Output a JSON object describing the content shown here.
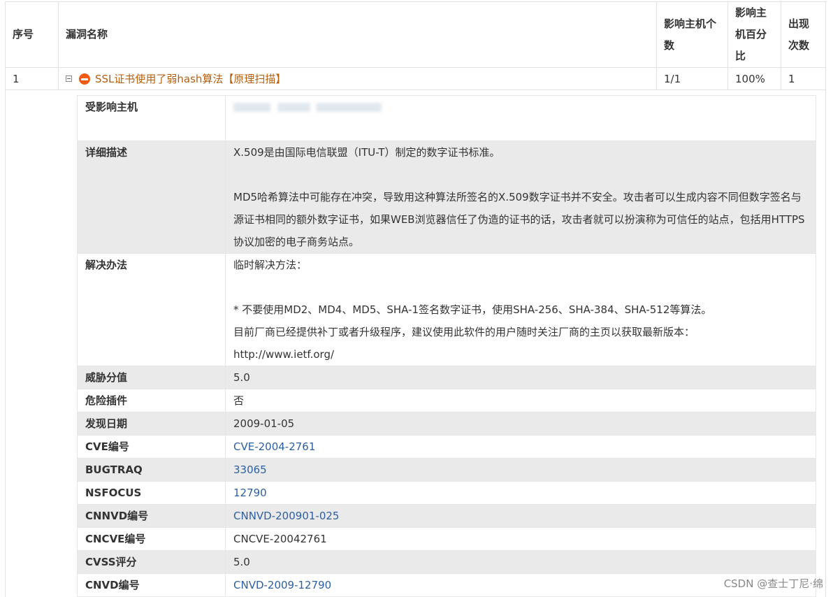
{
  "headers": {
    "seq": "序号",
    "name": "漏洞名称",
    "host_count": "影响主机个数",
    "host_pct": "影响主机百分比",
    "occurrences": "出现次数"
  },
  "vuln": {
    "seq": "1",
    "name": "SSL证书使用了弱hash算法【原理扫描】",
    "host_count": "1/1",
    "host_pct": "100%",
    "occurrences": "1",
    "icon": "danger-minus-icon",
    "expanded": true
  },
  "detail": {
    "affected_host": {
      "label": "受影响主机",
      "value": ""
    },
    "description": {
      "label": "详细描述",
      "p1": "X.509是由国际电信联盟（ITU-T）制定的数字证书标准。",
      "p2": "MD5哈希算法中可能存在冲突，导致用这种算法所签名的X.509数字证书并不安全。攻击者可以生成内容不同但数字签名与源证书相同的额外数字证书，如果WEB浏览器信任了伪造的证书的话，攻击者就可以扮演称为可信任的站点，包括用HTTPS协议加密的电子商务站点。"
    },
    "solution": {
      "label": "解决办法",
      "p1": "临时解决方法：",
      "p2": "* 不要使用MD2、MD4、MD5、SHA-1签名数字证书，使用SHA-256、SHA-384、SHA-512等算法。",
      "p3": "目前厂商已经提供补丁或者升级程序，建议使用此软件的用户随时关注厂商的主页以获取最新版本：",
      "p4": "http://www.ietf.org/"
    },
    "threat_score": {
      "label": "威胁分值",
      "value": "5.0"
    },
    "danger_plugin": {
      "label": "危险插件",
      "value": "否"
    },
    "found_date": {
      "label": "发现日期",
      "value": "2009-01-05"
    },
    "cve": {
      "label": "CVE编号",
      "value": "CVE-2004-2761"
    },
    "bugtraq": {
      "label": "BUGTRAQ",
      "value": "33065"
    },
    "nsfocus": {
      "label": "NSFOCUS",
      "value": "12790"
    },
    "cnnvd": {
      "label": "CNNVD编号",
      "value": "CNNVD-200901-025"
    },
    "cncve": {
      "label": "CNCVE编号",
      "value": "CNCVE-20042761"
    },
    "cvss": {
      "label": "CVSS评分",
      "value": "5.0"
    },
    "cnvd": {
      "label": "CNVD编号",
      "value": "CNVD-2009-12790"
    }
  },
  "watermark": "CSDN @查士丁尼·绵",
  "colors": {
    "link_blue": "#2d5fa0",
    "vuln_orange": "#b75e0d",
    "danger_icon": "#f05a13",
    "row_gray": "#eaeaea"
  }
}
